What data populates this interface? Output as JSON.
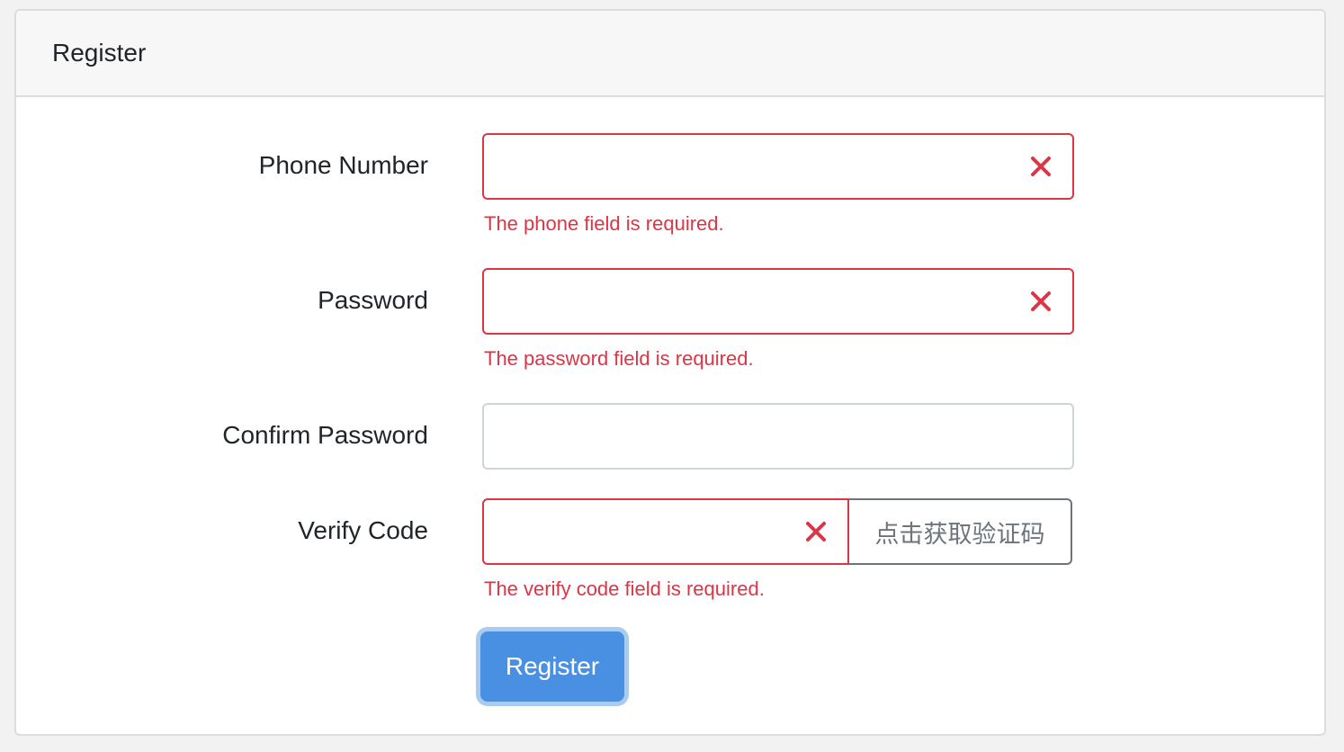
{
  "card": {
    "title": "Register"
  },
  "form": {
    "phone": {
      "label": "Phone Number",
      "value": "",
      "placeholder": "",
      "error": "The phone field is required."
    },
    "password": {
      "label": "Password",
      "value": "",
      "placeholder": "",
      "error": "The password field is required."
    },
    "confirm_password": {
      "label": "Confirm Password",
      "value": "",
      "placeholder": ""
    },
    "verify_code": {
      "label": "Verify Code",
      "value": "",
      "placeholder": "",
      "error": "The verify code field is required.",
      "button_label": "点击获取验证码"
    },
    "submit_label": "Register"
  },
  "colors": {
    "error": "#dc3545",
    "primary": "#4a90e2",
    "focus_ring": "#a9cbf0",
    "border": "#cfd4d9",
    "secondary": "#6c757d"
  },
  "icons": {
    "invalid": "close-x-icon"
  }
}
